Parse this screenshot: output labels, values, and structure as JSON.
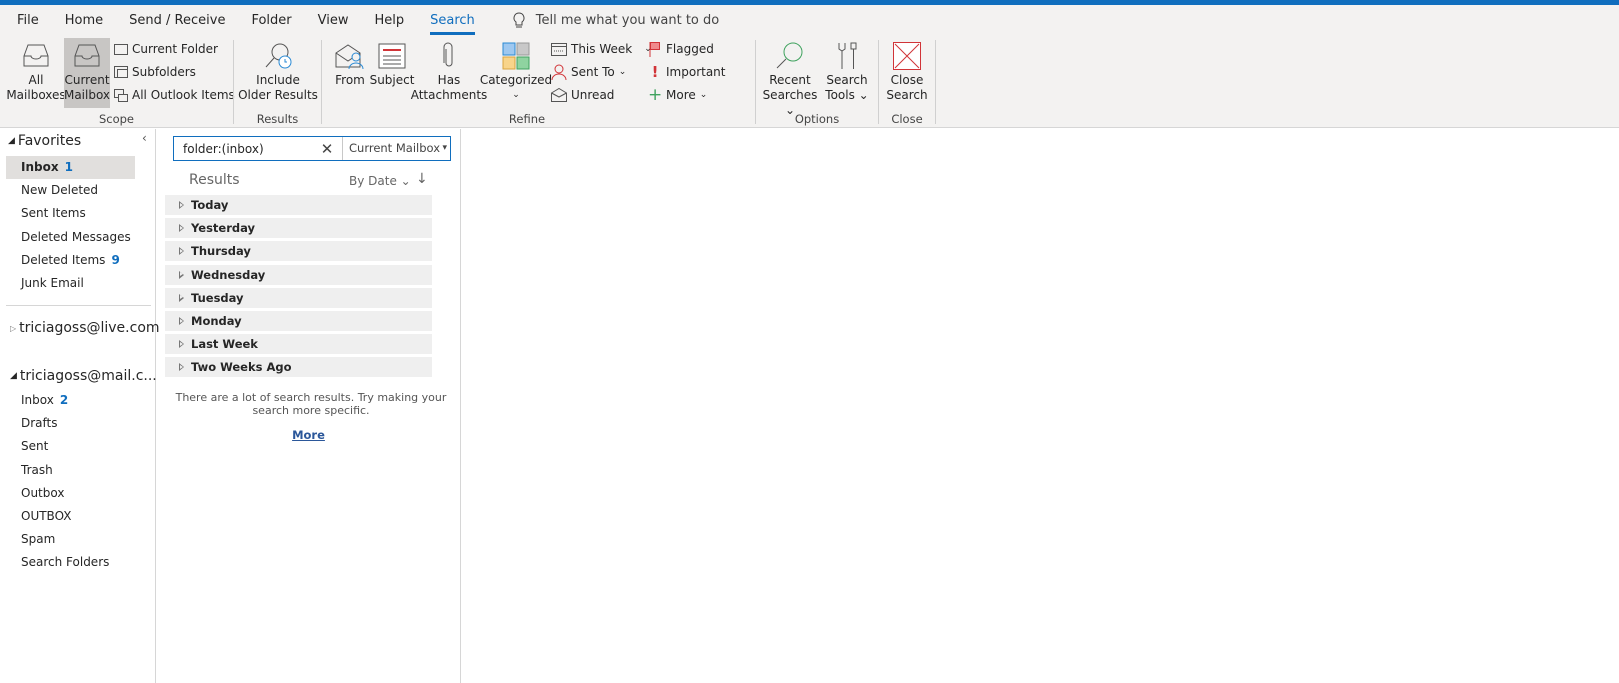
{
  "accent": "#106ebe",
  "tabs": [
    "File",
    "Home",
    "Send / Receive",
    "Folder",
    "View",
    "Help",
    "Search"
  ],
  "active_tab": "Search",
  "tell_me": "Tell me what you want to do",
  "ribbon": {
    "scope": {
      "label": "Scope",
      "all_mailboxes": [
        "All",
        "Mailboxes"
      ],
      "current_mailbox": [
        "Current",
        "Mailbox"
      ],
      "current_folder": "Current Folder",
      "subfolders": "Subfolders",
      "all_outlook_items": "All Outlook Items"
    },
    "results": {
      "label": "Results",
      "include_older": [
        "Include",
        "Older Results"
      ]
    },
    "refine": {
      "label": "Refine",
      "from": "From",
      "subject": "Subject",
      "has_attachments": [
        "Has",
        "Attachments"
      ],
      "categorized": "Categorized",
      "this_week": "This Week",
      "sent_to": "Sent To",
      "unread": "Unread",
      "flagged": "Flagged",
      "important": "Important",
      "more": "More"
    },
    "options": {
      "label": "Options",
      "recent_searches": [
        "Recent",
        "Searches"
      ],
      "search_tools": [
        "Search",
        "Tools"
      ]
    },
    "close": {
      "label": "Close",
      "close_search": [
        "Close",
        "Search"
      ]
    }
  },
  "nav": {
    "favorites_label": "Favorites",
    "favorites": [
      {
        "label": "Inbox",
        "count": "1",
        "selected": true
      },
      {
        "label": "New Deleted"
      },
      {
        "label": "Sent Items"
      },
      {
        "label": "Deleted Messages"
      },
      {
        "label": "Deleted Items",
        "count": "9"
      },
      {
        "label": "Junk Email"
      }
    ],
    "account1": "triciagoss@live.com",
    "account2": "triciagoss@mail.c...",
    "account2_folders": [
      {
        "label": "Inbox",
        "count": "2"
      },
      {
        "label": "Drafts"
      },
      {
        "label": "Sent"
      },
      {
        "label": "Trash"
      },
      {
        "label": "Outbox"
      },
      {
        "label": "OUTBOX"
      },
      {
        "label": "Spam"
      },
      {
        "label": "Search Folders"
      }
    ]
  },
  "search": {
    "query": "folder:(inbox)",
    "scope": "Current Mailbox"
  },
  "results": {
    "header": "Results",
    "sort": "By Date",
    "groups": [
      "Today",
      "Yesterday",
      "Thursday",
      "Wednesday",
      "Tuesday",
      "Monday",
      "Last Week",
      "Two Weeks Ago"
    ],
    "note": "There are a lot of search results. Try making your search more specific.",
    "more": "More"
  }
}
